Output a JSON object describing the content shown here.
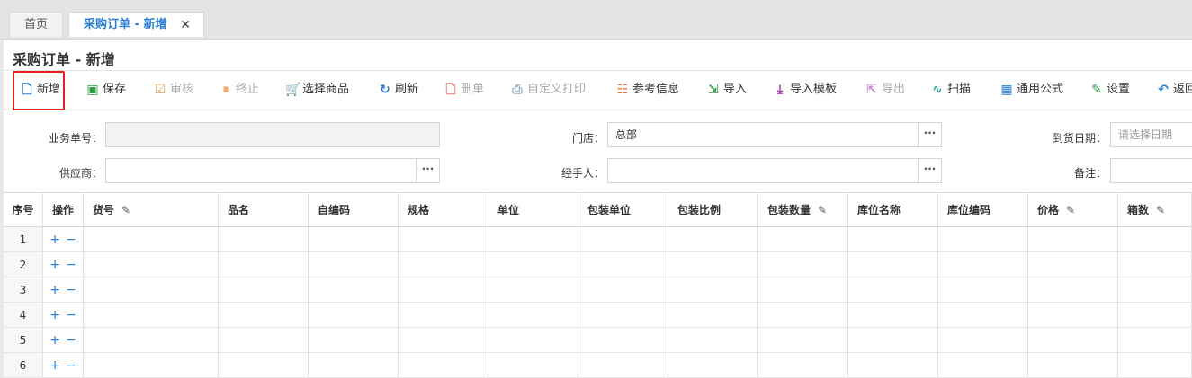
{
  "tabs": [
    {
      "label": "首页",
      "active": false
    },
    {
      "label": "采购订单 - 新增",
      "active": true
    }
  ],
  "tab_close_symbol": "✕",
  "page_title": "采购订单 - 新增",
  "toolbar": [
    {
      "label": "新增",
      "icon": "file-add-icon",
      "glyph": "🗋",
      "color": "#2a7ed3",
      "disabled": false
    },
    {
      "label": "保存",
      "icon": "save-icon",
      "glyph": "▣",
      "color": "#2e9d3f",
      "disabled": false
    },
    {
      "label": "审核",
      "icon": "check-box-icon",
      "glyph": "☑",
      "color": "#f0a45a",
      "disabled": true
    },
    {
      "label": "终止",
      "icon": "pause-circle-icon",
      "glyph": "⏸",
      "color": "#f0a45a",
      "disabled": true
    },
    {
      "label": "选择商品",
      "icon": "cart-icon",
      "glyph": "🛒",
      "color": "#2a7ed3",
      "disabled": false
    },
    {
      "label": "刷新",
      "icon": "refresh-icon",
      "glyph": "↻",
      "color": "#2a7ed3",
      "disabled": false
    },
    {
      "label": "删单",
      "icon": "delete-doc-icon",
      "glyph": "🗋",
      "color": "#e77a7a",
      "disabled": true
    },
    {
      "label": "自定义打印",
      "icon": "printer-icon",
      "glyph": "⎙",
      "color": "#9ab",
      "disabled": true
    },
    {
      "label": "参考信息",
      "icon": "info-list-icon",
      "glyph": "☷",
      "color": "#e8702a",
      "disabled": false
    },
    {
      "label": "导入",
      "icon": "import-icon",
      "glyph": "⇲",
      "color": "#2e9d3f",
      "disabled": false
    },
    {
      "label": "导入模板",
      "icon": "download-icon",
      "glyph": "⤓",
      "color": "#a020a0",
      "disabled": false
    },
    {
      "label": "导出",
      "icon": "export-icon",
      "glyph": "⇱",
      "color": "#c58ad6",
      "disabled": true
    },
    {
      "label": "扫描",
      "icon": "scan-wave-icon",
      "glyph": "∿",
      "color": "#2aa08a",
      "disabled": false
    },
    {
      "label": "通用公式",
      "icon": "calculator-icon",
      "glyph": "▦",
      "color": "#2a7ed3",
      "disabled": false
    },
    {
      "label": "设置",
      "icon": "edit-settings-icon",
      "glyph": "✎",
      "color": "#2e9d3f",
      "disabled": false
    },
    {
      "label": "返回",
      "icon": "back-arrow-icon",
      "glyph": "↶",
      "color": "#2a7ed3",
      "disabled": false
    }
  ],
  "form": {
    "order_no": {
      "label": "业务单号：",
      "value": ""
    },
    "store": {
      "label": "门店：",
      "value": "总部"
    },
    "arrival_date": {
      "label": "到货日期：",
      "placeholder": "请选择日期"
    },
    "supplier": {
      "label": "供应商：",
      "value": ""
    },
    "handler": {
      "label": "经手人：",
      "value": ""
    },
    "remark": {
      "label": "备注：",
      "value": ""
    },
    "ellipsis": "···"
  },
  "grid": {
    "columns": [
      "序号",
      "操作",
      "货号",
      "品名",
      "自编码",
      "规格",
      "单位",
      "包装单位",
      "包装比例",
      "包装数量",
      "库位名称",
      "库位编码",
      "价格",
      "箱数"
    ],
    "editable_columns": [
      "货号",
      "包装数量",
      "价格",
      "箱数"
    ],
    "rows": [
      "1",
      "2",
      "3",
      "4",
      "5",
      "6"
    ],
    "row_actions": {
      "add": "+",
      "remove": "−"
    }
  },
  "colors": {
    "accent": "#2a7ed3",
    "highlight": "#e02020"
  }
}
